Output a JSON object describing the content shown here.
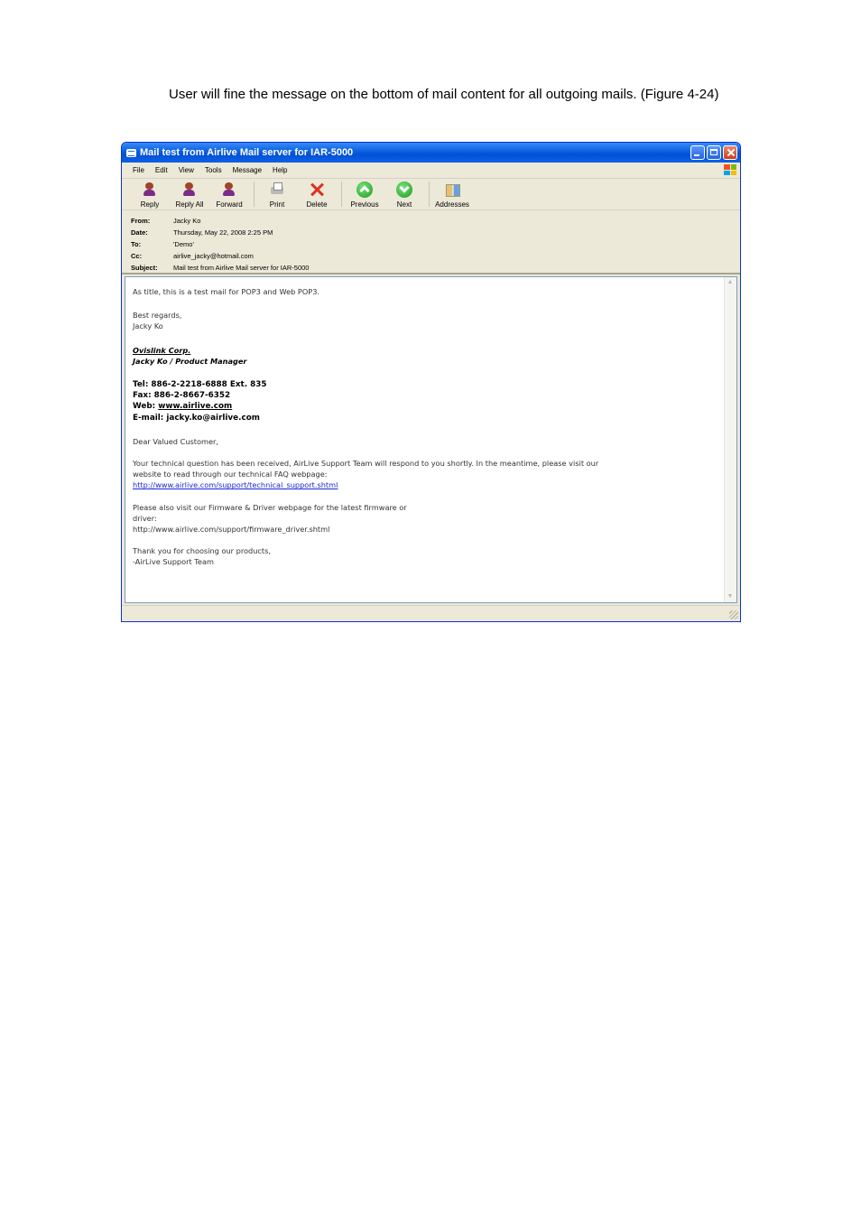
{
  "document": {
    "caption": "User will fine the message on the bottom of mail content for all outgoing mails. (Figure 4-24)"
  },
  "window": {
    "title": "Mail test from Airlive Mail server for IAR-5000"
  },
  "menu": {
    "items": [
      "File",
      "Edit",
      "View",
      "Tools",
      "Message",
      "Help"
    ]
  },
  "toolbar": {
    "reply": "Reply",
    "reply_all": "Reply All",
    "forward": "Forward",
    "print": "Print",
    "delete": "Delete",
    "previous": "Previous",
    "next": "Next",
    "addresses": "Addresses"
  },
  "headers": {
    "from_label": "From:",
    "from": "Jacky Ko",
    "date_label": "Date:",
    "date": "Thursday, May 22, 2008 2:25 PM",
    "to_label": "To:",
    "to": "'Demo'",
    "cc_label": "Cc:",
    "cc": "airlive_jacky@hotmail.com",
    "subject_label": "Subject:",
    "subject": "Mail test from Airlive Mail server for IAR-5000"
  },
  "message": {
    "intro": "As title, this is a test mail for POP3 and Web POP3.",
    "regards": "Best regards,",
    "name": "Jacky Ko",
    "company": "Ovislink Corp.",
    "title": "Jacky Ko / Product Manager",
    "tel": "Tel: 886-2-2218-6888 Ext. 835",
    "fax": "Fax: 886-2-8667-6352",
    "web_label": "Web: ",
    "web": "www.airlive.com",
    "email": "E-mail: jacky.ko@airlive.com",
    "greeting": "Dear Valued Customer,",
    "para1_line1": "Your technical question has been received, AirLive Support Team will respond to you shortly. In the meantime, please visit our",
    "para1_line2": "website to read through our technical FAQ webpage:",
    "faq_link": "http://www.airlive.com/support/technical_support.shtml",
    "para2_line1": "Please also visit our Firmware & Driver webpage for the latest firmware or",
    "para2_line2": "driver:",
    "firmware_url": "http://www.airlive.com/support/firmware_driver.shtml",
    "thanks": "Thank you for choosing our products,",
    "team": "-AirLive Support Team"
  }
}
